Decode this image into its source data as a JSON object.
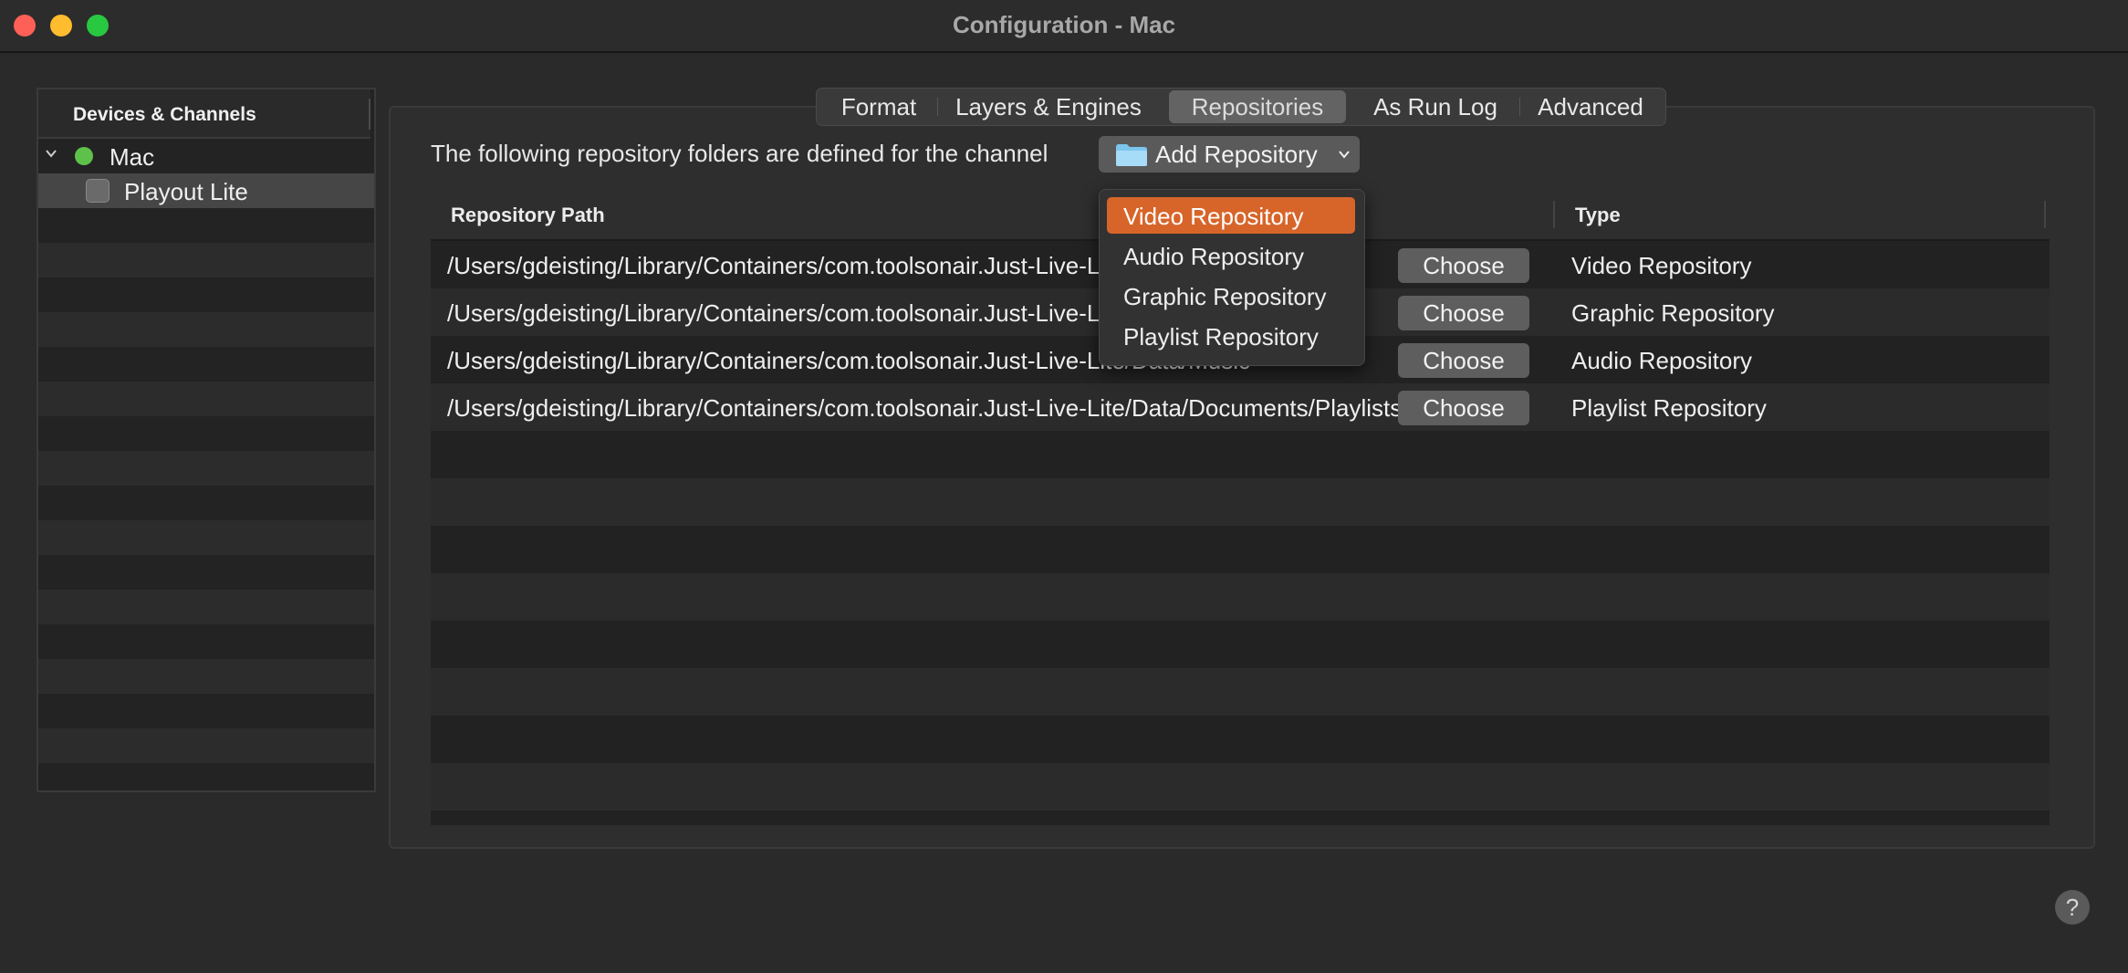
{
  "window": {
    "title": "Configuration - Mac"
  },
  "sidebar": {
    "header": "Devices & Channels",
    "items": [
      {
        "label": "Mac",
        "status": "green"
      },
      {
        "label": "Playout Lite"
      }
    ]
  },
  "tabs": [
    {
      "label": "Format"
    },
    {
      "label": "Layers & Engines"
    },
    {
      "label": "Repositories",
      "active": true
    },
    {
      "label": "As Run Log"
    },
    {
      "label": "Advanced"
    }
  ],
  "main": {
    "description": "The following repository folders are defined for the channel",
    "add_button_label": "Add Repository",
    "table": {
      "columns": [
        "Repository Path",
        "Type"
      ],
      "rows": [
        {
          "path": "/Users/gdeisting/Library/Containers/com.toolsonair.Just-Live-Lite/Data/Movies",
          "button": "Choose",
          "type": "Video Repository"
        },
        {
          "path": "/Users/gdeisting/Library/Containers/com.toolsonair.Just-Live-Lite/Data/Pictures",
          "button": "Choose",
          "type": "Graphic Repository"
        },
        {
          "path": "/Users/gdeisting/Library/Containers/com.toolsonair.Just-Live-Lite/Data/Music",
          "button": "Choose",
          "type": "Audio Repository"
        },
        {
          "path": "/Users/gdeisting/Library/Containers/com.toolsonair.Just-Live-Lite/Data/Documents/Playlists",
          "button": "Choose",
          "type": "Playlist Repository"
        }
      ]
    }
  },
  "dropdown": {
    "items": [
      "Video Repository",
      "Audio Repository",
      "Graphic Repository",
      "Playlist Repository"
    ],
    "highlighted": "Video Repository"
  },
  "help_label": "?",
  "colors": {
    "accent": "#d7652a",
    "status_green": "#5ec24a"
  }
}
